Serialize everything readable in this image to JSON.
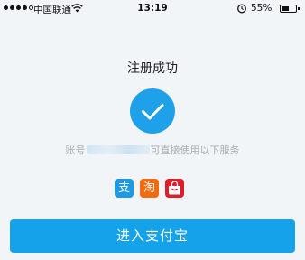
{
  "status_bar": {
    "signal_dots": 5,
    "carrier": "中国联通",
    "wifi_icon": "wifi-icon",
    "time": "13:19",
    "alarm_icon": "alarm-icon",
    "battery_percent": "55%",
    "battery_level": 0.55
  },
  "main": {
    "title": "注册成功",
    "check_icon": "check-circle-icon",
    "account_prefix": "账号",
    "account_suffix": "可直接使用以下服务",
    "services": [
      {
        "name": "alipay-icon",
        "glyph": "支",
        "color": "#1d9ae3"
      },
      {
        "name": "taobao-icon",
        "glyph": "淘",
        "color": "#f46a0c"
      },
      {
        "name": "tmall-icon",
        "glyph": "",
        "color": "#dd1e2a"
      }
    ],
    "enter_button_label": "进入支付宝"
  },
  "colors": {
    "accent": "#14a2ea",
    "background": "#f2f5f8"
  }
}
